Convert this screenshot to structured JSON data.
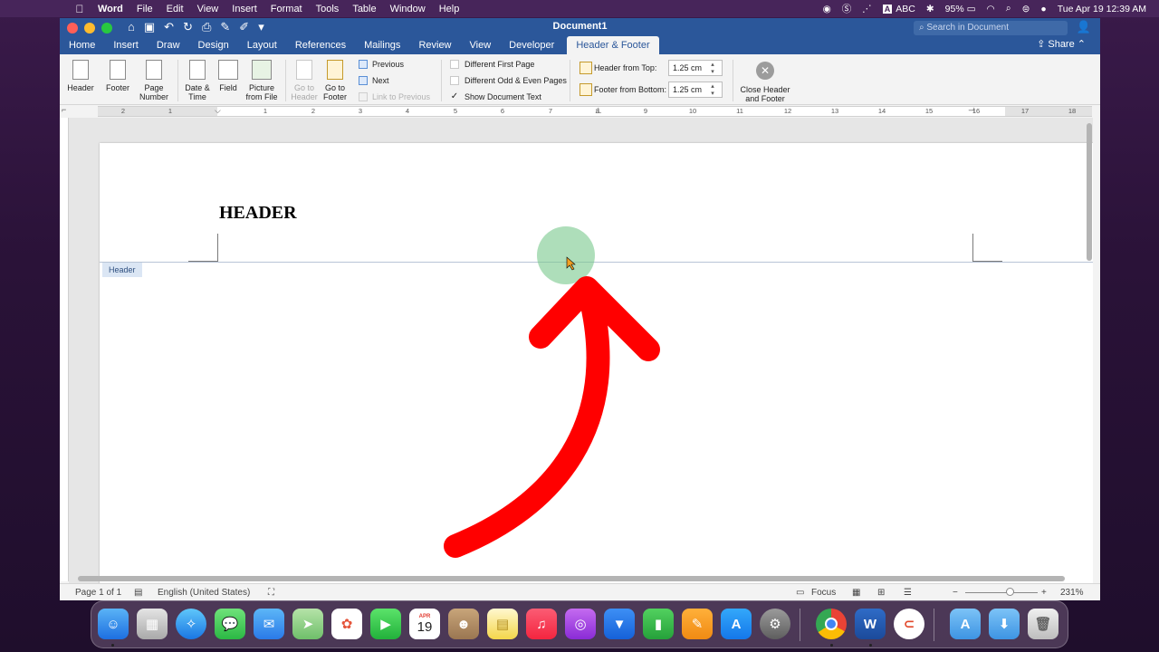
{
  "menubar": {
    "app_name": "Word",
    "items": [
      "File",
      "Edit",
      "View",
      "Insert",
      "Format",
      "Tools",
      "Table",
      "Window",
      "Help"
    ],
    "input_source": "ABC",
    "battery": "95%",
    "clock": "Tue Apr 19  12:39 AM"
  },
  "window": {
    "title": "Document1",
    "search_placeholder": "Search in Document",
    "share_label": "Share"
  },
  "tabs": [
    "Home",
    "Insert",
    "Draw",
    "Design",
    "Layout",
    "References",
    "Mailings",
    "Review",
    "View",
    "Developer"
  ],
  "active_tab": "Header & Footer",
  "ribbon": {
    "header": "Header",
    "footer": "Footer",
    "page_number_1": "Page",
    "page_number_2": "Number",
    "date_time_1": "Date &",
    "date_time_2": "Time",
    "field": "Field",
    "picture_1": "Picture",
    "picture_2": "from File",
    "go_header_1": "Go to",
    "go_header_2": "Header",
    "go_footer_1": "Go to",
    "go_footer_2": "Footer",
    "previous": "Previous",
    "next": "Next",
    "link_previous": "Link to Previous",
    "diff_first": "Different First Page",
    "diff_odd_even": "Different Odd & Even Pages",
    "show_doc_text": "Show Document Text",
    "header_from_top": "Header from Top:",
    "header_from_top_value": "1.25 cm",
    "footer_from_bottom": "Footer from Bottom:",
    "footer_from_bottom_value": "1.25 cm",
    "close_1": "Close Header",
    "close_2": "and Footer"
  },
  "ruler_numbers": [
    "2",
    "1",
    "1",
    "2",
    "3",
    "4",
    "5",
    "6",
    "7",
    "8",
    "9",
    "10",
    "11",
    "12",
    "13",
    "14",
    "15",
    "16",
    "17",
    "18"
  ],
  "document": {
    "header_text": "HEADER",
    "header_tag": "Header"
  },
  "status": {
    "page": "Page 1 of 1",
    "language": "English (United States)",
    "focus": "Focus",
    "zoom": "231%"
  },
  "dock": {
    "calendar_month": "APR",
    "calendar_day": "19"
  },
  "colors": {
    "word_blue": "#2b579a",
    "arrow_red": "#ff0000",
    "cursor_highlight": "#78c88c"
  }
}
